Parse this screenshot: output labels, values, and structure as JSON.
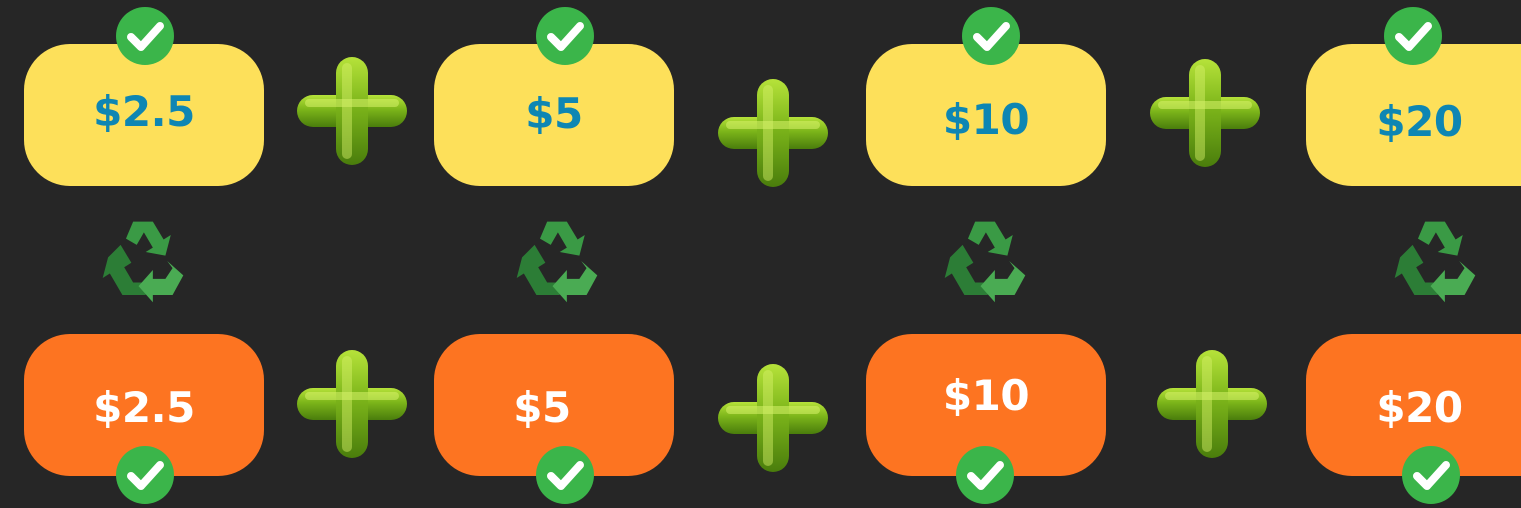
{
  "top_row": {
    "values": [
      "$2.5",
      "$5",
      "$10",
      "$20"
    ],
    "color": "#fde05a",
    "text_color": "#0e86b3"
  },
  "bottom_row": {
    "values": [
      "$2.5",
      "$5",
      "$10",
      "$20"
    ],
    "color": "#fd7421",
    "text_color": "#ffffff"
  },
  "icons": {
    "check": "check-circle-icon",
    "plus": "plus-icon",
    "recycle": "recycle-icon"
  },
  "colors": {
    "background": "#262626",
    "check_green": "#3bb54a",
    "plus_green": "#6aa312",
    "recycle_green": "#2e8b3a"
  }
}
